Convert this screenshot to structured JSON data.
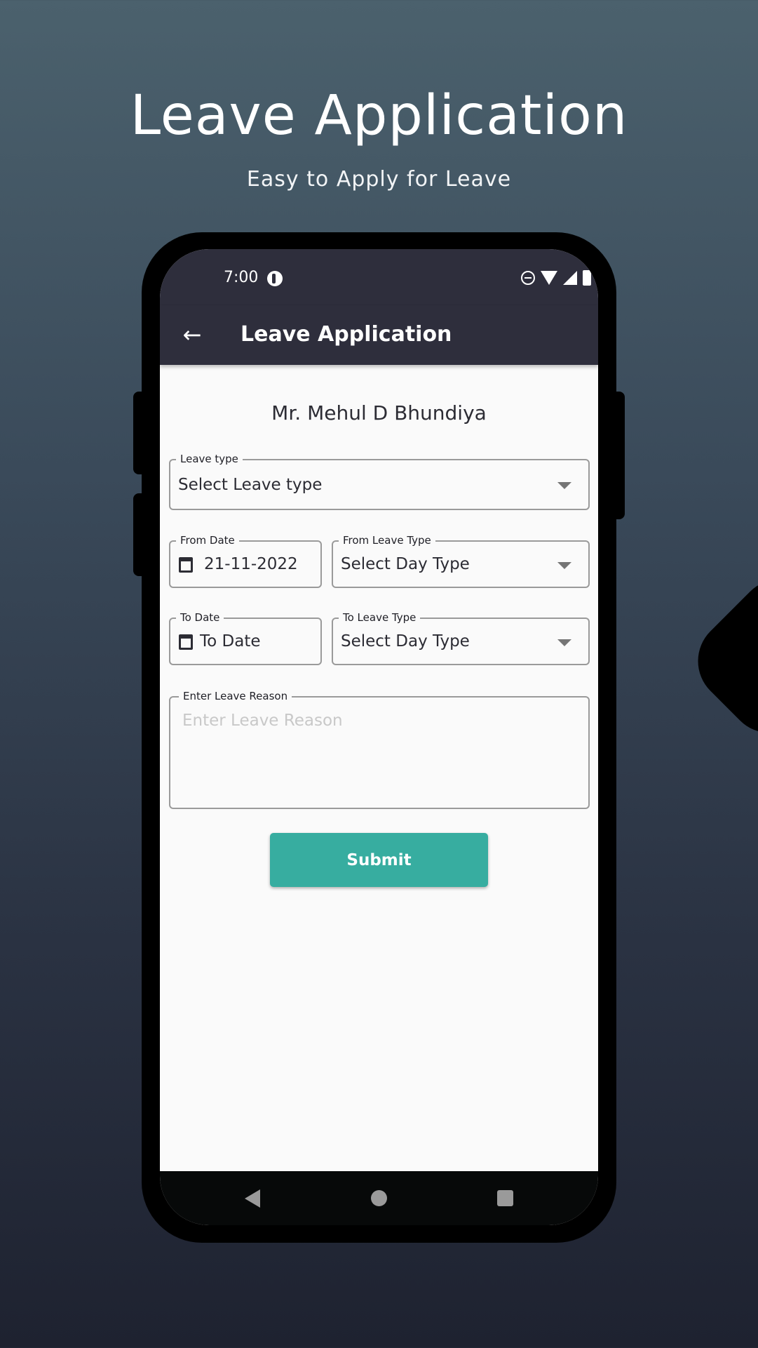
{
  "hero": {
    "title": "Leave Application",
    "subtitle": "Easy to Apply for Leave"
  },
  "status_bar": {
    "time": "7:00",
    "icons": [
      "app-notification-icon",
      "do-not-disturb-icon",
      "wifi-icon",
      "signal-icon",
      "battery-icon"
    ]
  },
  "app_bar": {
    "back_icon": "←",
    "title": "Leave Application"
  },
  "form": {
    "employee_name": "Mr. Mehul D Bhundiya",
    "leave_type": {
      "label": "Leave type",
      "value": "Select Leave type"
    },
    "from_date": {
      "label": "From Date",
      "value": "21-11-2022"
    },
    "from_leave_type": {
      "label": "From Leave Type",
      "value": "Select Day Type"
    },
    "to_date": {
      "label": "To Date",
      "value": "To Date"
    },
    "to_leave_type": {
      "label": "To Leave Type",
      "value": "Select Day Type"
    },
    "reason": {
      "label": "Enter Leave Reason",
      "placeholder": "Enter Leave Reason",
      "value": ""
    },
    "submit_label": "Submit"
  },
  "nav_bar": {
    "buttons": [
      "back",
      "home",
      "recents"
    ]
  },
  "colors": {
    "app_bar": "#2e2e3c",
    "accent": "#37ada0",
    "screen_bg": "#fafafa",
    "outline": "#9a9a9a"
  }
}
